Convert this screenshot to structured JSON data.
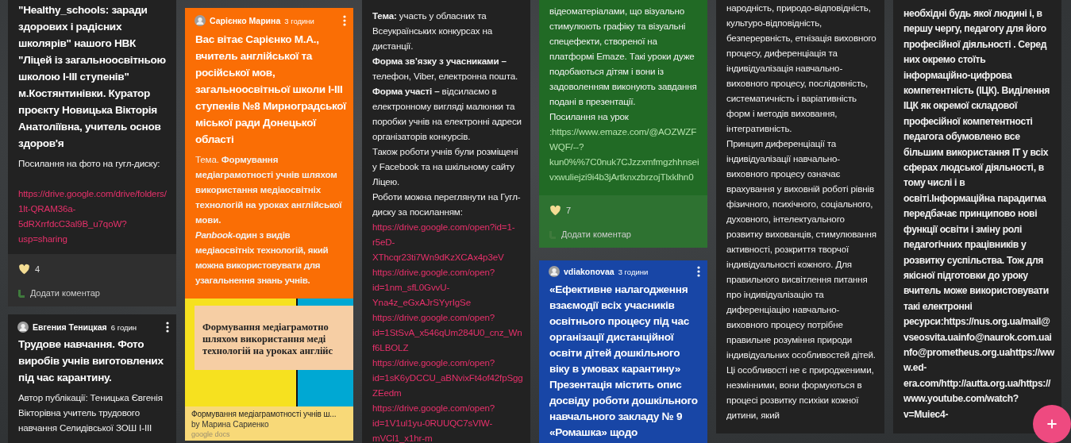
{
  "board": {
    "columns": [
      {
        "posts": [
          {
            "color": "#222222",
            "title": "\"Healthy_schools: заради здорових і радісних школярів\" нашого НВК \"Ліцей із загальноосвітньою школою I-III ступенів\" м.Костянтинівки. Куратор проєкту Новицька Вікторія Анатоліївна, учитель основ здоров'я",
            "blocks": [
              {
                "kind": "text",
                "text": "Посилання на фото на гугл-диску:"
              },
              {
                "kind": "link",
                "spaced": true,
                "text": "https://drive.google.com/drive/folders/1lt-QRAM36a-5dRXrrfdcC3al9B_u7qoW?usp=sharing"
              }
            ],
            "likes": "4",
            "comment_label": "Додати коментар"
          },
          {
            "color": "#222222",
            "author": {
              "name": "Евгения Теницкая",
              "time": "6 годин"
            },
            "title": "Трудове навчання. Фото виробів учнів виготовлених під час карантину.",
            "blocks": [
              {
                "kind": "text",
                "text": "Автор публікації: Теницька Євгенія Вікторівна учитель трудового навчання Селидівської ЗОШ I-III"
              }
            ]
          }
        ]
      },
      {
        "posts": [
          {
            "color": "#fa6e05",
            "author": {
              "name": "Сарієнко Марина",
              "time": "3 години"
            },
            "title": "Вас вітає Сарієнко М.А., вчитель англійської та російської мов, загальноосвітньої школи I-III ступенів №8 Мирноградської міської ради Донецької області",
            "blocks": [
              {
                "kind": "text",
                "text": "Тема. **Формування медіаграмотності учнів шляхом використання медіаосвітніх технологій на уроках англійської мови.**"
              },
              {
                "kind": "strong",
                "text": "*Panbook*-один з видів медіаосвітніх технологій, який можна використовувати для узагальнення  знань  учнів."
              }
            ],
            "attachment": {
              "preview_lines": [
                "Формування медіаграмотно",
                "шляхом використання меді",
                "технологій на уроках англійс"
              ],
              "title": "Формування медіаграмотності учнів ш...",
              "byline": "by Марина Сариенко",
              "source": "google docs"
            }
          }
        ]
      },
      {
        "posts": [
          {
            "color": "#222222",
            "blocks": [
              {
                "kind": "text",
                "text": "**Тема:** участь у обласних та Всеукраїнських конкурсах на дистанції."
              },
              {
                "kind": "text",
                "text": "**Форма зв’язку з учасниками –** телефон, Viber, електронна пошта."
              },
              {
                "kind": "text",
                "text": "**Форма участі –** відсилаємо в електронному вигляді малюнки та поробки учнів на електронні адреси організаторів конкурсів."
              },
              {
                "kind": "text",
                "text": "Також роботи учнів були розміщені у Facebook та на шкільному сайту Ліцею."
              },
              {
                "kind": "text",
                "text": "Роботи можна переглянути на Гугл-диску за посиланням:"
              },
              {
                "kind": "link",
                "text": "https://drive.google.com/open?id=1-r5eD-XThcqr23ti7Wn9dKzXCAx4p3eV"
              },
              {
                "kind": "link",
                "text": "https://drive.google.com/open?id=1nm_sfL0GvvU-Yna4z_eGxAJrSYyrIgSe"
              },
              {
                "kind": "link",
                "text": "https://drive.google.com/open?id=1StSvA_x546qUm284U0_cnz_Wnf6LBOLZ"
              },
              {
                "kind": "link",
                "text": "https://drive.google.com/open?id=1sK6yDCCU_aBNvixFt4of42fpSggZEedm"
              },
              {
                "kind": "link",
                "text": "https://drive.google.com/open?id=1V1ul1yu-0RUUQC7sVIW-mVCl1_x1hr-m"
              }
            ]
          }
        ]
      },
      {
        "posts": [
          {
            "color": "#216a25",
            "blocks": [
              {
                "kind": "text",
                "text": "відеоматеріалами, що візуально стимулюють графіку та візуальні спецефекти,  створеної на платформі Emaze. Такі уроки дуже подобаються дітям і вони із задоволенням виконують завдання подані в презентації."
              },
              {
                "kind": "text",
                "text": " Посилання на урок"
              },
              {
                "kind": "link",
                "text": ":https://www.emaze.com/@AOZWZFWQF/--?kun0%%7C0nuk7CJzzxmfmgzhhnseivxwuliejzi9i4b3jArtknxzbrzojTlxklhn0"
              }
            ],
            "likes": "7",
            "comment_label": "Додати коментар"
          },
          {
            "color": "#1846a6",
            "author": {
              "name": "vdiakonovaa",
              "time": "3 години"
            },
            "title": "«Ефективне налагодження взаємодії всіх учасників освітнього процесу під час організації дистанційної освіти дітей дошкільного віку в умовах карантину» Презентація містить опис досвіду роботи дошкільного навчального закладу № 9 «Ромашка» щодо"
          }
        ]
      },
      {
        "posts": [
          {
            "color": "#222222",
            "blocks": [
              {
                "kind": "text",
                "text": "народність, природо-відповідність, культуро-відповідність, безперервність, етнізація виховного процесу, диференціація та індивідуалізація навчально-виховного процесу, послідовність, систематичність і варіативність форм і методів виховання, інтегративність."
              },
              {
                "kind": "text",
                "text": "Принцип диференціації та індивідуалізації навчально-виховного процесу означає врахування у виховній роботі рівнів фізичного, психічного, соціального, духовного, інтелектуального розвитку вихованців, стимулювання активності, розкриття творчої індивідуальності кожного. Для правильного висвітлення питання про індивідуалізацію та диференціацію навчально-виховного процесу потрібне правильне розуміння природи індивідуальних особливостей дітей. Ці особливості не є природженими, незмінними, вони формуються в процесі розвитку психіки кожної дитини, який"
              }
            ]
          }
        ]
      },
      {
        "posts": [
          {
            "color": "#222222",
            "blocks": [
              {
                "kind": "strong",
                "text": "необхідні будь якої людині і, в першу чергу, педагогу для його професійної діяльності . Серед них окремо стоїть інформаційно-цифрова компетентність (ІЦК). Виділення ІЦК як окремої складової професійної компетентності педагога обумовлено все більшим використання ІТ у всіх сферах людської діяльності, в тому числі і в освіті.Інформаційна парадигма передбачає принципово нові функції освіти і зміну ролі педагогічних працівників у розвитку суспільства. Тож для якісної підготовки до уроку вчитель може використовувати такі електронні ресурси:https://nus.org.ua/mail@vseosvita.uainfo@naurok.com.uainfo@prometheus.org.uahttps://www.ed-era.com/http://autta.org.ua/https://www.youtube.com/watch?v=Muiec4-"
              }
            ]
          }
        ]
      }
    ]
  }
}
